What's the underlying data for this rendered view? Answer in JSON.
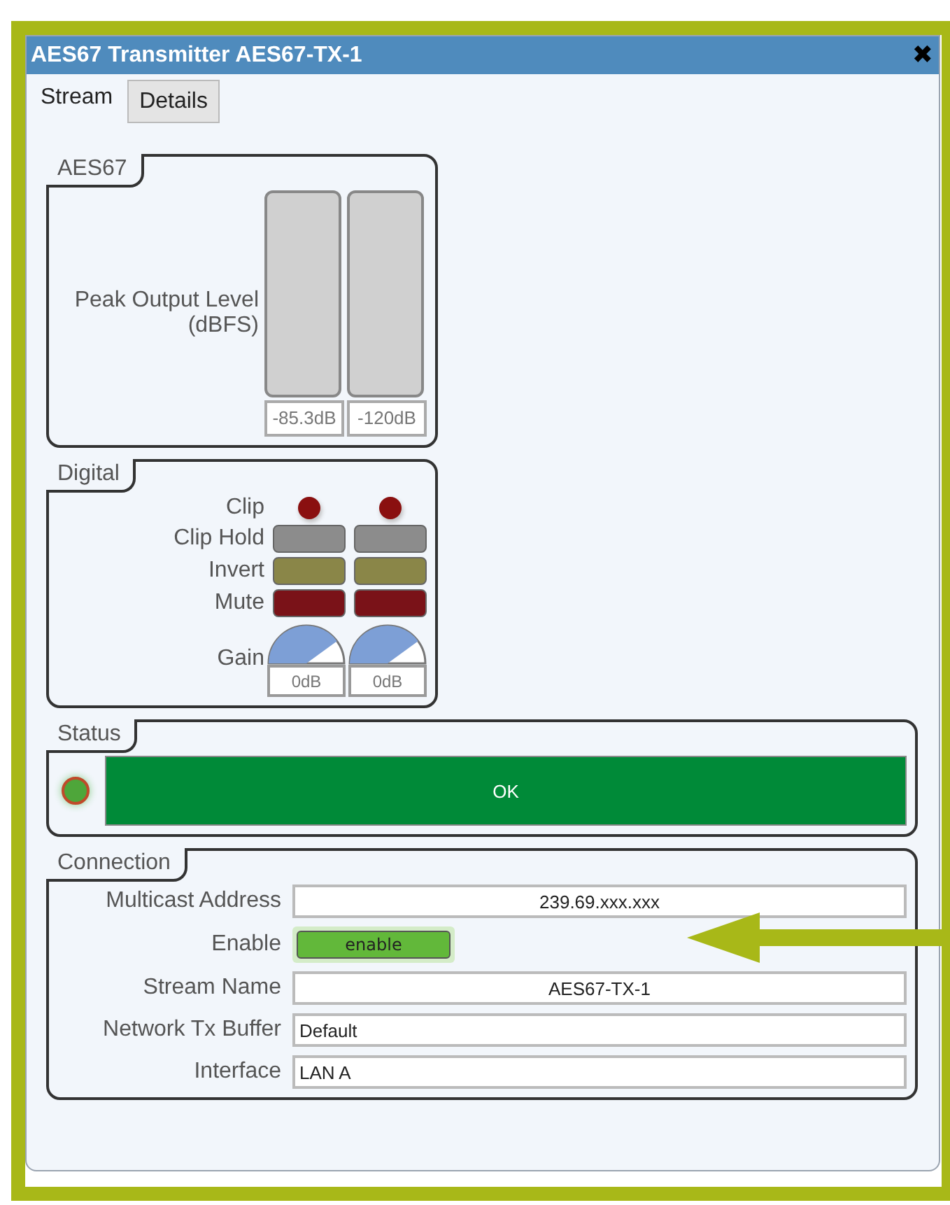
{
  "window": {
    "title": "AES67 Transmitter AES67-TX-1",
    "close": "✖"
  },
  "tabs": [
    {
      "label": "Stream",
      "selected": true
    },
    {
      "label": "Details",
      "selected": false
    }
  ],
  "aes67": {
    "title": "AES67",
    "label": "Peak Output Level\n(dBFS)",
    "meters": [
      {
        "reading": "-85.3dB"
      },
      {
        "reading": "-120dB"
      }
    ]
  },
  "digital": {
    "title": "Digital",
    "rows": [
      {
        "label": "Clip",
        "kind": "led",
        "color": "#8a1010"
      },
      {
        "label": "Clip Hold",
        "kind": "button",
        "color": "#8c8c8c"
      },
      {
        "label": "Invert",
        "kind": "button",
        "color": "#8a8648"
      },
      {
        "label": "Mute",
        "kind": "button",
        "color": "#7a1218"
      },
      {
        "label": "Gain",
        "kind": "knob",
        "knobs": [
          {
            "reading": "0dB"
          },
          {
            "reading": "0dB"
          }
        ]
      }
    ]
  },
  "status": {
    "title": "Status",
    "led_on": true,
    "text": "OK"
  },
  "connection": {
    "title": "Connection",
    "rows": [
      {
        "label": "Multicast Address",
        "kind": "centered",
        "value": "239.69.xxx.xxx"
      },
      {
        "label": "Enable",
        "kind": "toggle",
        "value": "enable",
        "on": true
      },
      {
        "label": "Stream Name",
        "kind": "centered",
        "value": "AES67-TX-1"
      },
      {
        "label": "Network Tx Buffer",
        "kind": "field",
        "value": "Default"
      },
      {
        "label": "Interface",
        "kind": "field",
        "value": "LAN A"
      }
    ]
  }
}
